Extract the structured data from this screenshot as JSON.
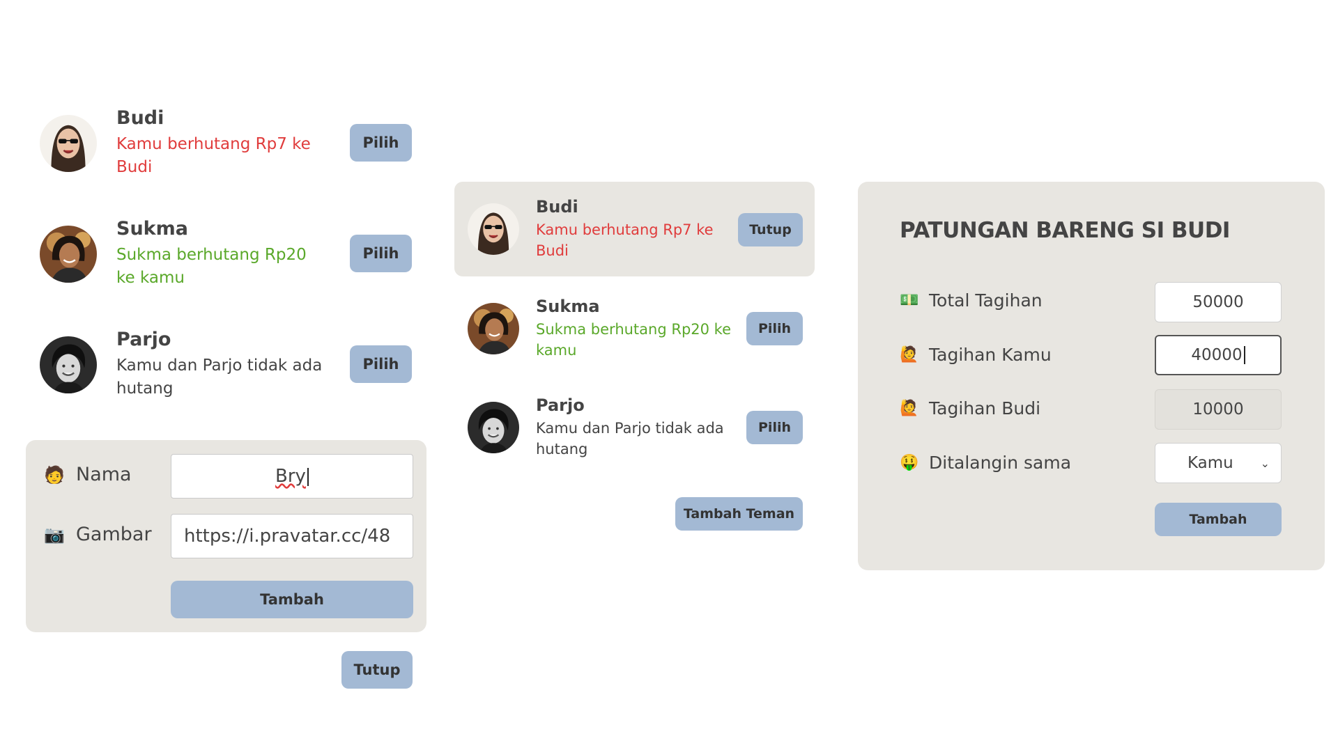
{
  "left_list": [
    {
      "name": "Budi",
      "status": "Kamu berhutang Rp7 ke Budi",
      "status_type": "red",
      "button": "Pilih"
    },
    {
      "name": "Sukma",
      "status": "Sukma berhutang Rp20 ke kamu",
      "status_type": "green",
      "button": "Pilih"
    },
    {
      "name": "Parjo",
      "status": "Kamu dan Parjo tidak ada hutang",
      "status_type": "gray",
      "button": "Pilih"
    }
  ],
  "add_form": {
    "name_label": "Nama",
    "name_value": "Bry",
    "image_label": "Gambar",
    "image_value": "https://i.pravatar.cc/48",
    "submit": "Tambah",
    "close": "Tutup"
  },
  "middle_list": [
    {
      "name": "Budi",
      "status": "Kamu berhutang Rp7 ke Budi",
      "status_type": "red",
      "button": "Tutup"
    },
    {
      "name": "Sukma",
      "status": "Sukma berhutang Rp20 ke kamu",
      "status_type": "green",
      "button": "Pilih"
    },
    {
      "name": "Parjo",
      "status": "Kamu dan Parjo tidak ada hutang",
      "status_type": "gray",
      "button": "Pilih"
    }
  ],
  "add_friend_button": "Tambah Teman",
  "split_form": {
    "title": "PATUNGAN BARENG SI BUDI",
    "total_label": "Total Tagihan",
    "total_value": "50000",
    "yours_label": "Tagihan Kamu",
    "yours_value": "40000",
    "friend_label": "Tagihan Budi",
    "friend_value": "10000",
    "payer_label": "Ditalangin sama",
    "payer_value": "Kamu",
    "submit": "Tambah"
  },
  "icons": {
    "nama": "person-emoji-icon",
    "gambar": "camera-emoji-icon",
    "total": "money-emoji-icon",
    "yours": "person-raising-hand-icon",
    "friend": "person-raising-hand-icon",
    "payer": "money-face-emoji-icon"
  },
  "colors": {
    "accent": "#a3b9d4",
    "panel": "#e8e6e1",
    "red": "#e03c3c",
    "green": "#5aa82a"
  }
}
